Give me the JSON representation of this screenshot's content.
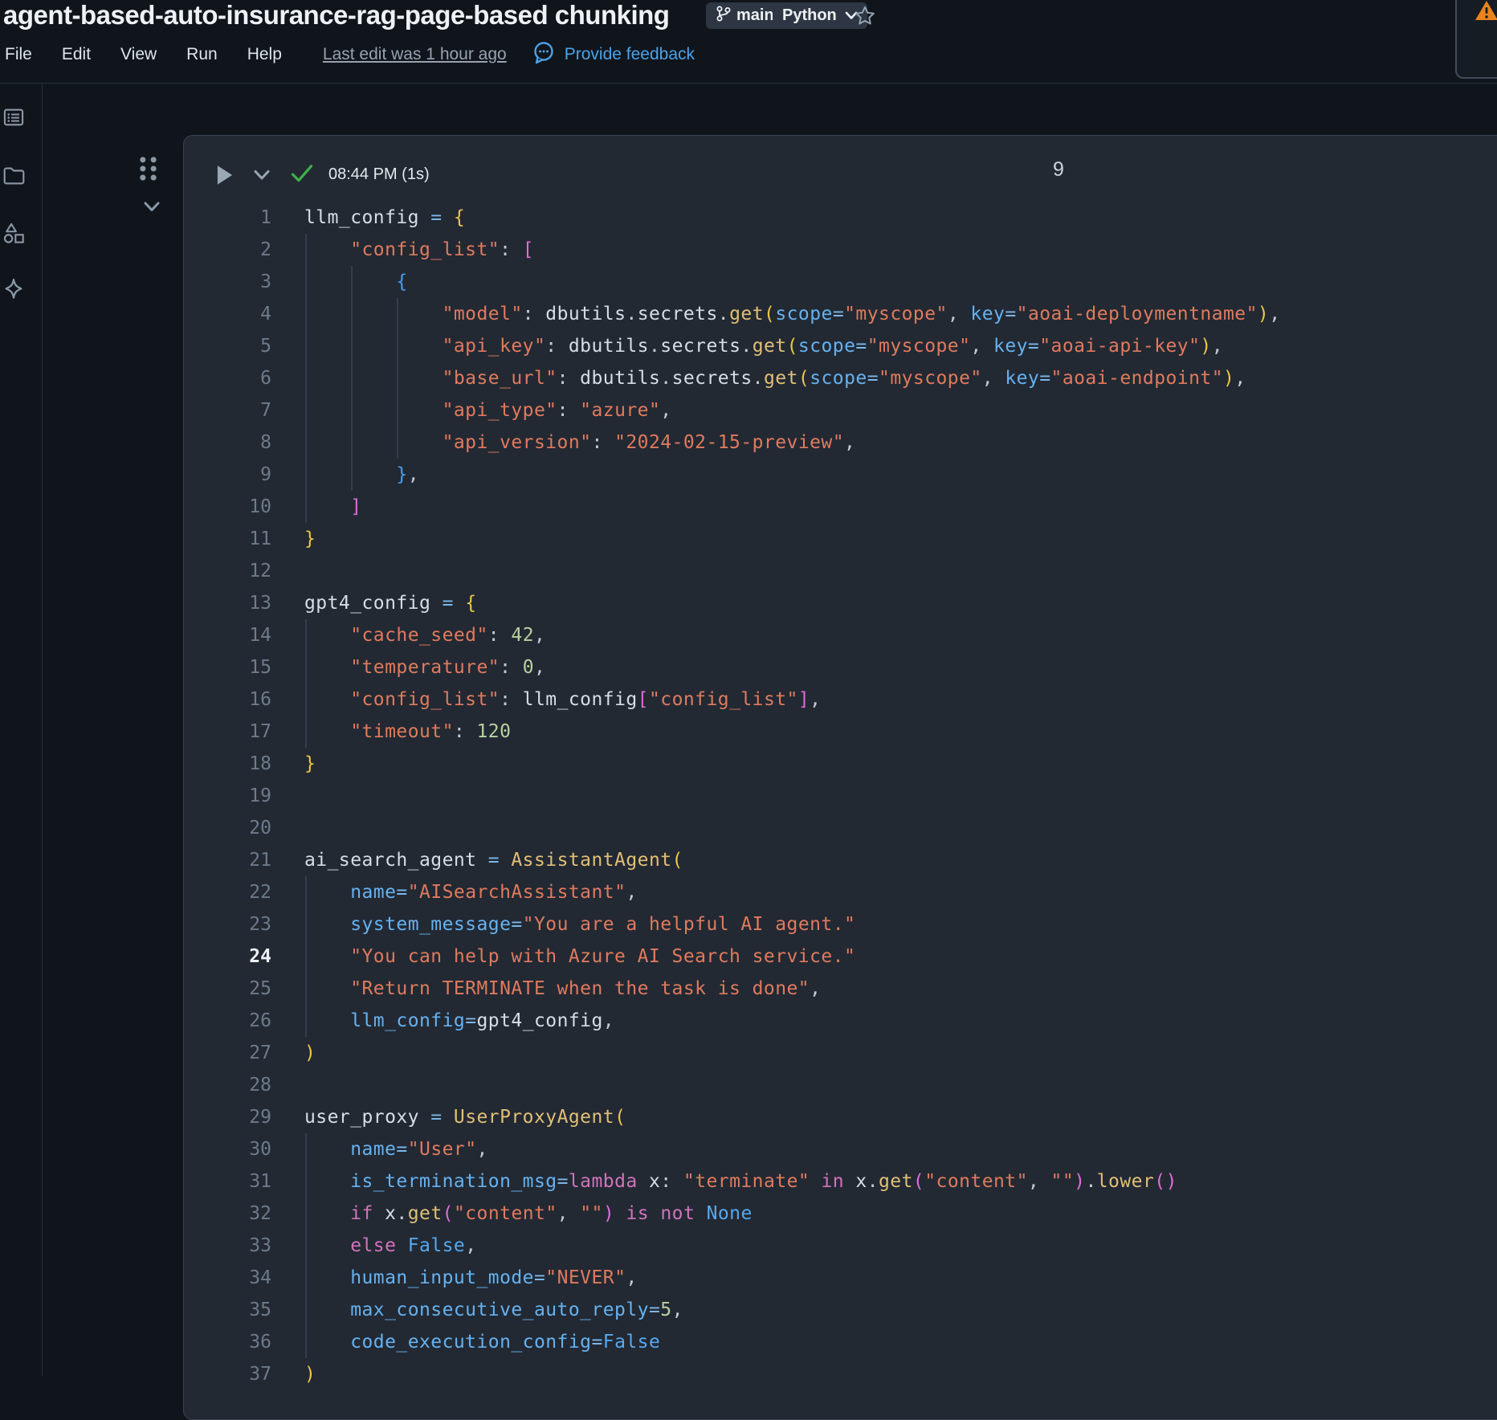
{
  "header": {
    "title": "agent-based-auto-insurance-rag-page-based chunking",
    "branch_label": "main",
    "language_label": "Python",
    "menu_items": [
      "File",
      "Edit",
      "View",
      "Run",
      "Help"
    ],
    "last_edit": "Last edit was 1 hour ago",
    "feedback_label": "Provide feedback"
  },
  "sidebar": {
    "items": [
      {
        "icon": "table-of-contents"
      },
      {
        "icon": "folder"
      },
      {
        "icon": "shapes"
      },
      {
        "icon": "assistant-sparkle"
      }
    ]
  },
  "cell": {
    "status_time": "08:44 PM (1s)",
    "cell_index": "9",
    "active_line": 24,
    "indent_guides": [
      {
        "level": 0,
        "from": 2,
        "to": 10
      },
      {
        "level": 1,
        "from": 3,
        "to": 9
      },
      {
        "level": 2,
        "from": 4,
        "to": 8
      },
      {
        "level": 0,
        "from": 14,
        "to": 17
      },
      {
        "level": 0,
        "from": 22,
        "to": 26
      },
      {
        "level": 0,
        "from": 30,
        "to": 36
      }
    ],
    "code_lines": [
      [
        [
          "v",
          "llm_config "
        ],
        [
          "eq",
          "= "
        ],
        [
          "b1",
          "{"
        ]
      ],
      [
        [
          "v",
          "    "
        ],
        [
          "s",
          "\"config_list\""
        ],
        [
          "o",
          ": "
        ],
        [
          "b2",
          "["
        ]
      ],
      [
        [
          "v",
          "        "
        ],
        [
          "b3",
          "{"
        ]
      ],
      [
        [
          "v",
          "            "
        ],
        [
          "s",
          "\"model\""
        ],
        [
          "o",
          ": "
        ],
        [
          "v",
          "dbutils"
        ],
        [
          "o",
          "."
        ],
        [
          "v",
          "secrets"
        ],
        [
          "o",
          "."
        ],
        [
          "f",
          "get"
        ],
        [
          "b1",
          "("
        ],
        [
          "p",
          "scope"
        ],
        [
          "eq",
          "="
        ],
        [
          "s",
          "\"myscope\""
        ],
        [
          "o",
          ", "
        ],
        [
          "p",
          "key"
        ],
        [
          "eq",
          "="
        ],
        [
          "s",
          "\"aoai-deploymentname\""
        ],
        [
          "b1",
          ")"
        ],
        [
          "o",
          ","
        ]
      ],
      [
        [
          "v",
          "            "
        ],
        [
          "s",
          "\"api_key\""
        ],
        [
          "o",
          ": "
        ],
        [
          "v",
          "dbutils"
        ],
        [
          "o",
          "."
        ],
        [
          "v",
          "secrets"
        ],
        [
          "o",
          "."
        ],
        [
          "f",
          "get"
        ],
        [
          "b1",
          "("
        ],
        [
          "p",
          "scope"
        ],
        [
          "eq",
          "="
        ],
        [
          "s",
          "\"myscope\""
        ],
        [
          "o",
          ", "
        ],
        [
          "p",
          "key"
        ],
        [
          "eq",
          "="
        ],
        [
          "s",
          "\"aoai-api-key\""
        ],
        [
          "b1",
          ")"
        ],
        [
          "o",
          ","
        ]
      ],
      [
        [
          "v",
          "            "
        ],
        [
          "s",
          "\"base_url\""
        ],
        [
          "o",
          ": "
        ],
        [
          "v",
          "dbutils"
        ],
        [
          "o",
          "."
        ],
        [
          "v",
          "secrets"
        ],
        [
          "o",
          "."
        ],
        [
          "f",
          "get"
        ],
        [
          "b1",
          "("
        ],
        [
          "p",
          "scope"
        ],
        [
          "eq",
          "="
        ],
        [
          "s",
          "\"myscope\""
        ],
        [
          "o",
          ", "
        ],
        [
          "p",
          "key"
        ],
        [
          "eq",
          "="
        ],
        [
          "s",
          "\"aoai-endpoint\""
        ],
        [
          "b1",
          ")"
        ],
        [
          "o",
          ","
        ]
      ],
      [
        [
          "v",
          "            "
        ],
        [
          "s",
          "\"api_type\""
        ],
        [
          "o",
          ": "
        ],
        [
          "s",
          "\"azure\""
        ],
        [
          "o",
          ","
        ]
      ],
      [
        [
          "v",
          "            "
        ],
        [
          "s",
          "\"api_version\""
        ],
        [
          "o",
          ": "
        ],
        [
          "s",
          "\"2024-02-15-preview\""
        ],
        [
          "o",
          ","
        ]
      ],
      [
        [
          "v",
          "        "
        ],
        [
          "b3",
          "}"
        ],
        [
          "o",
          ","
        ]
      ],
      [
        [
          "v",
          "    "
        ],
        [
          "b2",
          "]"
        ]
      ],
      [
        [
          "b1",
          "}"
        ]
      ],
      [],
      [
        [
          "v",
          "gpt4_config "
        ],
        [
          "eq",
          "= "
        ],
        [
          "b1",
          "{"
        ]
      ],
      [
        [
          "v",
          "    "
        ],
        [
          "s",
          "\"cache_seed\""
        ],
        [
          "o",
          ": "
        ],
        [
          "n",
          "42"
        ],
        [
          "o",
          ","
        ]
      ],
      [
        [
          "v",
          "    "
        ],
        [
          "s",
          "\"temperature\""
        ],
        [
          "o",
          ": "
        ],
        [
          "n",
          "0"
        ],
        [
          "o",
          ","
        ]
      ],
      [
        [
          "v",
          "    "
        ],
        [
          "s",
          "\"config_list\""
        ],
        [
          "o",
          ": "
        ],
        [
          "v",
          "llm_config"
        ],
        [
          "b2",
          "["
        ],
        [
          "s",
          "\"config_list\""
        ],
        [
          "b2",
          "]"
        ],
        [
          "o",
          ","
        ]
      ],
      [
        [
          "v",
          "    "
        ],
        [
          "s",
          "\"timeout\""
        ],
        [
          "o",
          ": "
        ],
        [
          "n",
          "120"
        ]
      ],
      [
        [
          "b1",
          "}"
        ]
      ],
      [],
      [],
      [
        [
          "v",
          "ai_search_agent "
        ],
        [
          "eq",
          "= "
        ],
        [
          "f",
          "AssistantAgent"
        ],
        [
          "b1",
          "("
        ]
      ],
      [
        [
          "v",
          "    "
        ],
        [
          "p",
          "name"
        ],
        [
          "eq",
          "="
        ],
        [
          "s",
          "\"AISearchAssistant\""
        ],
        [
          "o",
          ","
        ]
      ],
      [
        [
          "v",
          "    "
        ],
        [
          "p",
          "system_message"
        ],
        [
          "eq",
          "="
        ],
        [
          "s",
          "\"You are a helpful AI agent.\""
        ]
      ],
      [
        [
          "v",
          "    "
        ],
        [
          "s",
          "\"You can help with Azure AI Search service.\""
        ]
      ],
      [
        [
          "v",
          "    "
        ],
        [
          "s",
          "\"Return TERMINATE when the task is done\""
        ],
        [
          "o",
          ","
        ]
      ],
      [
        [
          "v",
          "    "
        ],
        [
          "p",
          "llm_config"
        ],
        [
          "eq",
          "="
        ],
        [
          "v",
          "gpt4_config"
        ],
        [
          "o",
          ","
        ]
      ],
      [
        [
          "b1",
          ")"
        ]
      ],
      [],
      [
        [
          "v",
          "user_proxy "
        ],
        [
          "eq",
          "= "
        ],
        [
          "f",
          "UserProxyAgent"
        ],
        [
          "b1",
          "("
        ]
      ],
      [
        [
          "v",
          "    "
        ],
        [
          "p",
          "name"
        ],
        [
          "eq",
          "="
        ],
        [
          "s",
          "\"User\""
        ],
        [
          "o",
          ","
        ]
      ],
      [
        [
          "v",
          "    "
        ],
        [
          "p",
          "is_termination_msg"
        ],
        [
          "eq",
          "="
        ],
        [
          "k",
          "lambda"
        ],
        [
          "v",
          " x"
        ],
        [
          "o",
          ": "
        ],
        [
          "s",
          "\"terminate\""
        ],
        [
          "k",
          " in "
        ],
        [
          "v",
          "x"
        ],
        [
          "o",
          "."
        ],
        [
          "f",
          "get"
        ],
        [
          "b2",
          "("
        ],
        [
          "s",
          "\"content\""
        ],
        [
          "o",
          ", "
        ],
        [
          "s",
          "\"\""
        ],
        [
          "b2",
          ")"
        ],
        [
          "o",
          "."
        ],
        [
          "f",
          "lower"
        ],
        [
          "b2",
          "("
        ],
        [
          "b2",
          ")"
        ]
      ],
      [
        [
          "v",
          "    "
        ],
        [
          "k",
          "if"
        ],
        [
          "v",
          " x"
        ],
        [
          "o",
          "."
        ],
        [
          "f",
          "get"
        ],
        [
          "b2",
          "("
        ],
        [
          "s",
          "\"content\""
        ],
        [
          "o",
          ", "
        ],
        [
          "s",
          "\"\""
        ],
        [
          "b2",
          ")"
        ],
        [
          "k",
          " is not "
        ],
        [
          "c",
          "None"
        ]
      ],
      [
        [
          "v",
          "    "
        ],
        [
          "k",
          "else"
        ],
        [
          "v",
          " "
        ],
        [
          "c",
          "False"
        ],
        [
          "o",
          ","
        ]
      ],
      [
        [
          "v",
          "    "
        ],
        [
          "p",
          "human_input_mode"
        ],
        [
          "eq",
          "="
        ],
        [
          "s",
          "\"NEVER\""
        ],
        [
          "o",
          ","
        ]
      ],
      [
        [
          "v",
          "    "
        ],
        [
          "p",
          "max_consecutive_auto_reply"
        ],
        [
          "eq",
          "="
        ],
        [
          "n",
          "5"
        ],
        [
          "o",
          ","
        ]
      ],
      [
        [
          "v",
          "    "
        ],
        [
          "p",
          "code_execution_config"
        ],
        [
          "eq",
          "="
        ],
        [
          "c",
          "False"
        ]
      ],
      [
        [
          "b1",
          ")"
        ]
      ]
    ]
  },
  "colors": {
    "page_bg": "#10151c",
    "cell_bg": "#222933",
    "accent_blue": "#4ba3e8",
    "string": "#e07a5e",
    "function": "#e2bf76",
    "parameter": "#66b2f0",
    "keyword": "#d173bb",
    "constant": "#57a8ee",
    "number": "#b9d0a0",
    "bracket_gold": "#e9c846",
    "bracket_orchid": "#df6bd8",
    "bracket_blue": "#459ef0",
    "success_green": "#3fae4a",
    "warning_orange": "#e8831f"
  }
}
